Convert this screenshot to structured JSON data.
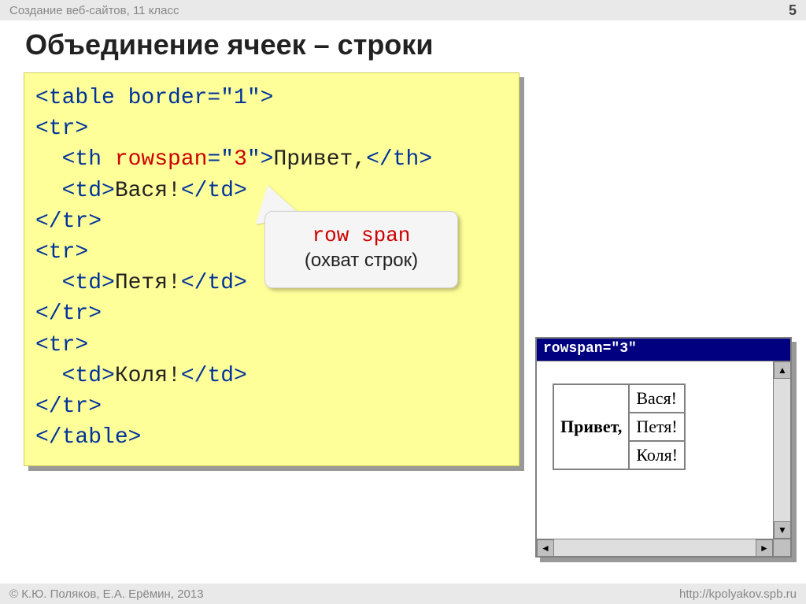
{
  "header": {
    "left": "Создание веб-сайтов, 11 класс",
    "page_number": "5"
  },
  "title": "Объединение ячеек – строки",
  "code": {
    "l01a": "<table border=\"1\">",
    "l02a": "<tr>",
    "l03a": "  <th ",
    "l03b": "rowspan",
    "l03c": "=\"",
    "l03d": "3",
    "l03e": "\">",
    "l03f": "Привет,",
    "l03g": "</th>",
    "l04a": "  <td>",
    "l04b": "Вася!",
    "l04c": "</td>",
    "l05a": "</tr>",
    "l06a": "<tr>",
    "l07a": "  <td>",
    "l07b": "Петя!",
    "l07c": "</td>",
    "l08a": "</tr>",
    "l09a": "<tr>",
    "l10a": "  <td>",
    "l10b": "Коля!",
    "l10c": "</td>",
    "l11a": "</tr>",
    "l12a": "</table>"
  },
  "callout": {
    "line1": "row span",
    "line2": "(охват строк)"
  },
  "mini_window": {
    "title": "rowspan=\"3\"",
    "table": {
      "th": "Привет,",
      "td1": "Вася!",
      "td2": "Петя!",
      "td3": "Коля!"
    }
  },
  "footer": {
    "left": "© К.Ю. Поляков, Е.А. Ерёмин, 2013",
    "right": "http://kpolyakov.spb.ru"
  }
}
